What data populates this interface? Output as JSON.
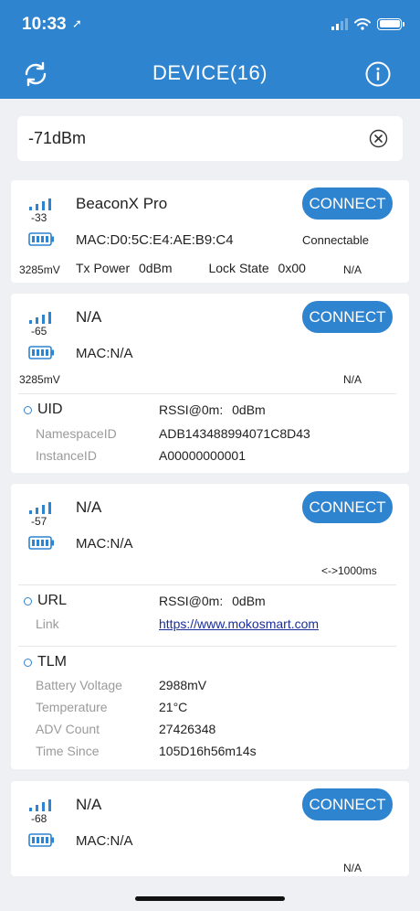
{
  "status_bar": {
    "time": "10:33",
    "location_glyph": "➚"
  },
  "header": {
    "title": "DEVICE(16)"
  },
  "search": {
    "value": "-71dBm"
  },
  "colors": {
    "accent": "#2f84d0",
    "link": "#1a2f99"
  },
  "devices": [
    {
      "rssi": "-33",
      "name": "BeaconX Pro",
      "mac": "MAC:D0:5C:E4:AE:B9:C4",
      "connect_label": "CONNECT",
      "connectable": "Connectable",
      "voltage": "3285mV",
      "tx_power_label": "Tx Power",
      "tx_power_value": "0dBm",
      "lock_state_label": "Lock State",
      "lock_state_value": "0x00",
      "interval": "N/A"
    },
    {
      "rssi": "-65",
      "name": "N/A",
      "mac": "MAC:N/A",
      "connect_label": "CONNECT",
      "voltage": "3285mV",
      "interval": "N/A",
      "uid": {
        "title": "UID",
        "rssi_label": "RSSI@0m:",
        "rssi_value": "0dBm",
        "namespace_label": "NamespaceID",
        "namespace_value": "ADB143488994071C8D43",
        "instance_label": "InstanceID",
        "instance_value": "A00000000001"
      }
    },
    {
      "rssi": "-57",
      "name": "N/A",
      "mac": "MAC:N/A",
      "connect_label": "CONNECT",
      "interval": "<->1000ms",
      "url": {
        "title": "URL",
        "rssi_label": "RSSI@0m:",
        "rssi_value": "0dBm",
        "link_label": "Link",
        "link_value": "https://www.mokosmart.com"
      },
      "tlm": {
        "title": "TLM",
        "battery_label": "Battery Voltage",
        "battery_value": "2988mV",
        "temp_label": "Temperature",
        "temp_value": "21°C",
        "adv_label": "ADV Count",
        "adv_value": "27426348",
        "time_label": "Time Since",
        "time_value": "105D16h56m14s"
      }
    },
    {
      "rssi": "-68",
      "name": "N/A",
      "mac": "MAC:N/A",
      "connect_label": "CONNECT",
      "interval": "N/A"
    }
  ]
}
